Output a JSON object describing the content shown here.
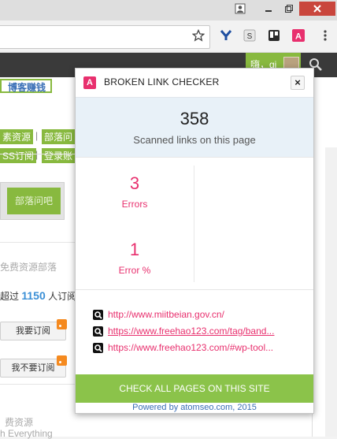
{
  "browser": {
    "tab_title": "",
    "toolbar_icons": [
      "star-icon",
      "y-extension-icon",
      "s-extension-icon",
      "trello-extension-icon",
      "atomseo-extension-icon",
      "kebab-menu-icon"
    ],
    "accent": "#e8306e"
  },
  "background_page": {
    "greeting": "嗨，gi",
    "hot_tag": "博客赚钱",
    "tags_row1": [
      "素资源",
      "部落问"
    ],
    "tags_row2": [
      "SS订阅",
      "登录账"
    ],
    "separator": "|",
    "nav_button": "部落问吧",
    "faded_text_1": "免费资源部落",
    "subscribe_prefix": "超过",
    "subscribe_count": "1150",
    "subscribe_suffix": "人订阅",
    "subscribe_button": "我要订阅",
    "unsubscribe_button": "我不要订阅",
    "faded_text_2": "费资源",
    "faded_text_3": "h Everything"
  },
  "popup": {
    "title": "BROKEN LINK CHECKER",
    "close_label": "×",
    "scanned_count": "358",
    "scanned_label": "Scanned links on this page",
    "errors_count": "3",
    "errors_label": "Errors",
    "error_percent": "1",
    "error_percent_label": "Error %",
    "links": [
      {
        "url": "http://www.miitbeian.gov.cn/"
      },
      {
        "url": "https://www.freehao123.com/tag/band..."
      },
      {
        "url": "https://www.freehao123.com/#wp-tool..."
      }
    ],
    "check_all_label": "CHECK ALL PAGES ON THIS SITE",
    "powered_by": "Powered by atomseo.com, 2015"
  }
}
